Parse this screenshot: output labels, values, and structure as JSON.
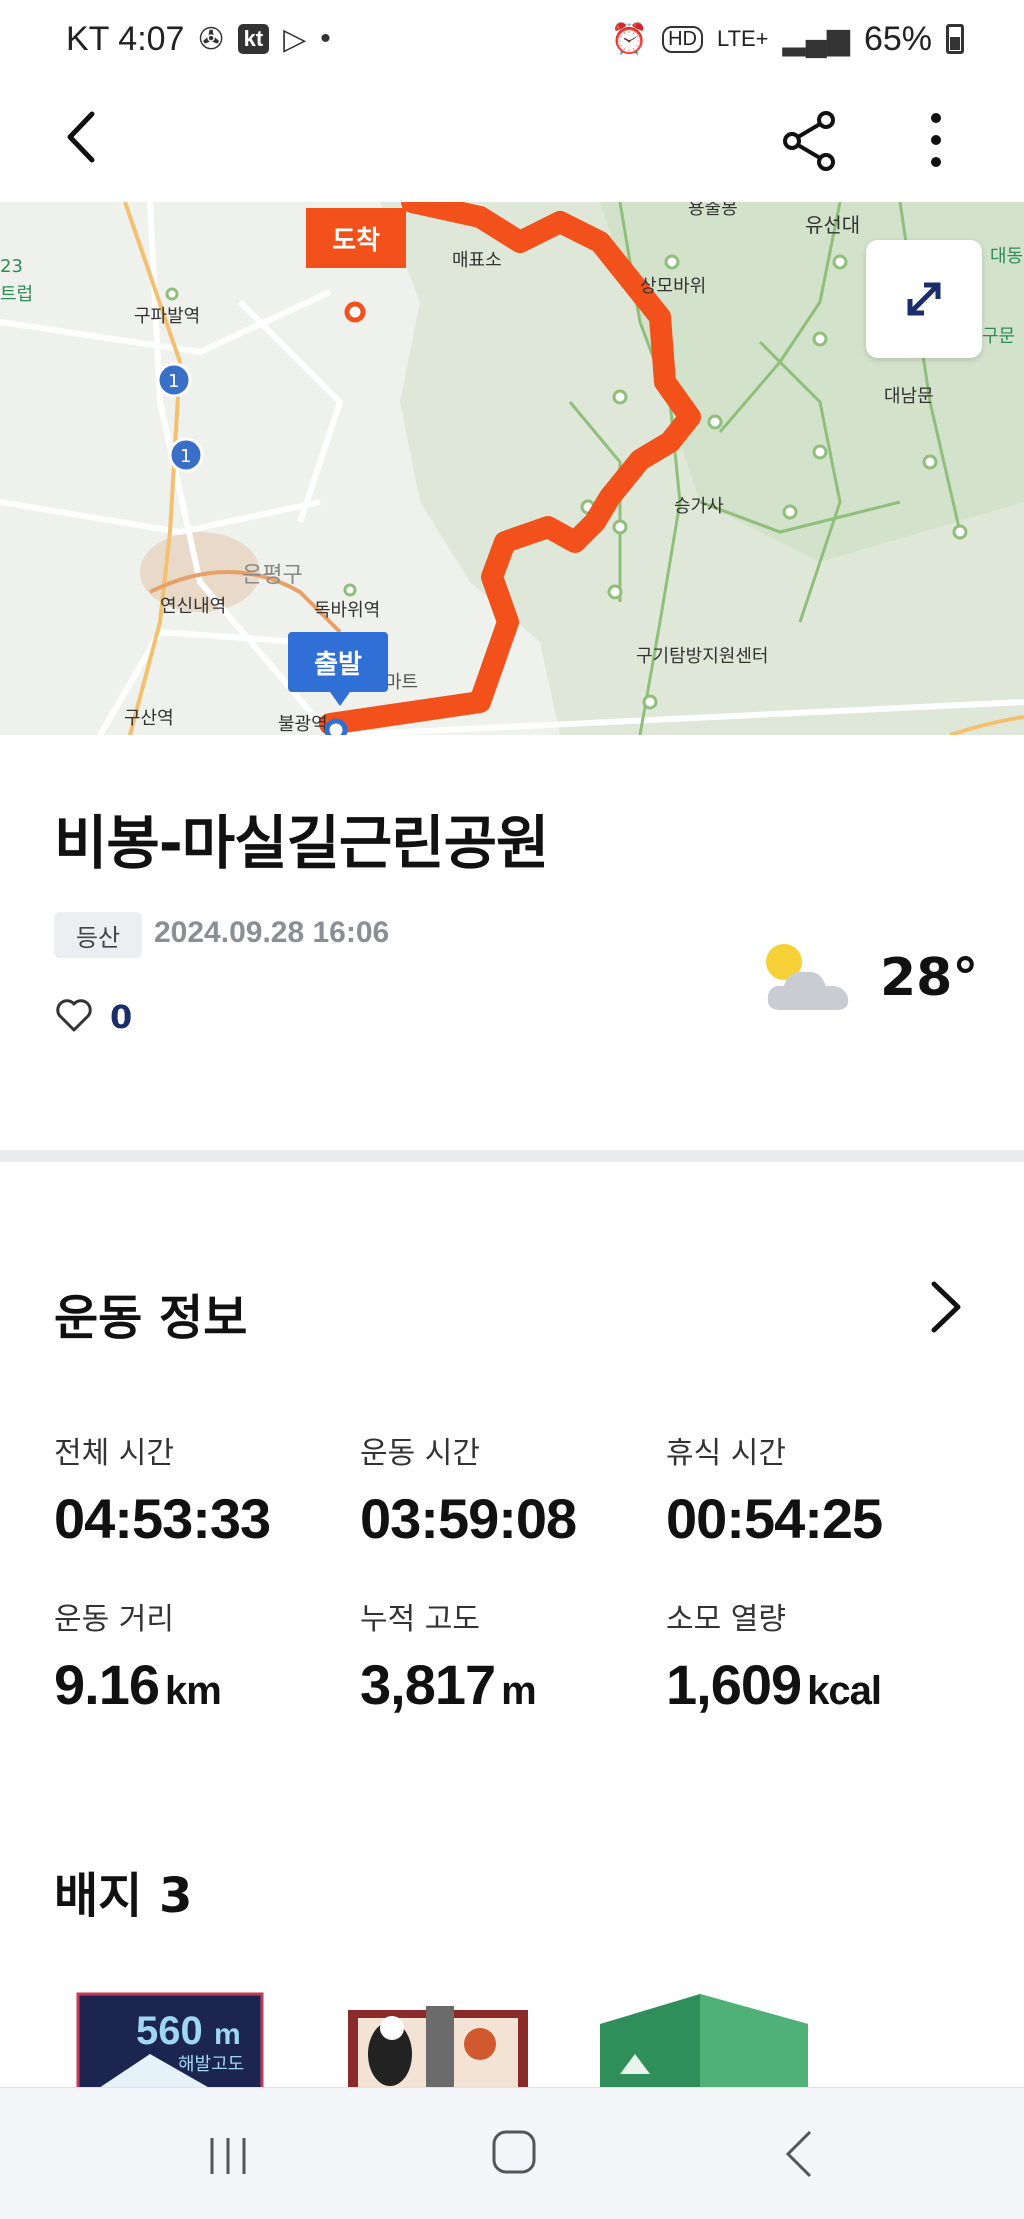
{
  "status_bar": {
    "carrier_time": "KT 4:07",
    "kt_badge": "kt",
    "hd": "HD",
    "lte": "LTE+",
    "battery": "65%"
  },
  "map": {
    "end_label": "도착",
    "start_label": "출발",
    "place_labels": {
      "gupabal": "구파발역",
      "yeonsinnae": "연신내역",
      "eunpyeong": "은평구",
      "dokbawi": "독바위역",
      "gusan": "구산역",
      "maepyo": "매표소",
      "sangmobawi": "상모바위",
      "seunggasa": "승가사",
      "gugi": "구기탐방지원센터",
      "daenammun": "대남문",
      "yuseondae": "유선대",
      "yongchulbong": "용출봉",
      "num23": "23",
      "left_edge": "트럽",
      "right_top": "대동",
      "right_mid": "구문",
      "bulgwang": "불광역",
      "mart": "마트",
      "line1a": "1",
      "line1b": "1"
    },
    "route_color": "#f2511b"
  },
  "activity": {
    "title": "비봉-마실길근린공원",
    "category": "등산",
    "datetime": "2024.09.28 16:06",
    "likes": "0",
    "temperature": "28°"
  },
  "exercise": {
    "section_title": "운동 정보",
    "stats": [
      {
        "label": "전체 시간",
        "value": "04:53:33",
        "unit": ""
      },
      {
        "label": "운동 시간",
        "value": "03:59:08",
        "unit": ""
      },
      {
        "label": "휴식 시간",
        "value": "00:54:25",
        "unit": ""
      },
      {
        "label": "운동 거리",
        "value": "9.16",
        "unit": "km"
      },
      {
        "label": "누적 고도",
        "value": "3,817",
        "unit": "m"
      },
      {
        "label": "소모 열량",
        "value": "1,609",
        "unit": "kcal"
      }
    ]
  },
  "badges": {
    "section_title": "배지 3",
    "altitude_badge_value": "560",
    "altitude_badge_unit": "m",
    "altitude_badge_caption": "해발고도"
  },
  "icons": [
    "back-arrow-icon",
    "share-icon",
    "more-vertical-icon",
    "expand-icon",
    "heart-icon",
    "weather-partly-cloudy-icon",
    "chevron-right-icon"
  ]
}
